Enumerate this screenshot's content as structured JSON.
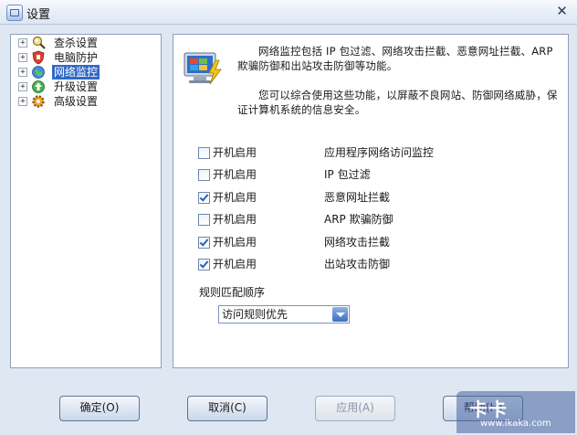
{
  "window": {
    "title": "设置",
    "close_symbol": "✕"
  },
  "tree": {
    "expander_symbol": "+",
    "items": [
      {
        "label": "查杀设置",
        "icon": "scan-icon"
      },
      {
        "label": "电脑防护",
        "icon": "shield-icon"
      },
      {
        "label": "网络监控",
        "icon": "network-icon",
        "selected": true
      },
      {
        "label": "升级设置",
        "icon": "update-icon"
      },
      {
        "label": "高级设置",
        "icon": "gear-icon"
      }
    ]
  },
  "content": {
    "desc_line1": "网络监控包括 IP 包过滤、网络攻击拦截、恶意网址拦截、ARP 欺骗防御和出站攻击防御等功能。",
    "desc_line2": "您可以综合使用这些功能，以屏蔽不良网站、防御网络威胁，保证计算机系统的信息安全。",
    "rows": [
      {
        "label": "开机启用",
        "feature": "应用程序网络访问监控",
        "checked": false
      },
      {
        "label": "开机启用",
        "feature": "IP 包过滤",
        "checked": false
      },
      {
        "label": "开机启用",
        "feature": "恶意网址拦截",
        "checked": true
      },
      {
        "label": "开机启用",
        "feature": "ARP 欺骗防御",
        "checked": false
      },
      {
        "label": "开机启用",
        "feature": "网络攻击拦截",
        "checked": true
      },
      {
        "label": "开机启用",
        "feature": "出站攻击防御",
        "checked": true
      }
    ],
    "rule_label": "规则匹配顺序",
    "rule_value": "访问规则优先"
  },
  "buttons": {
    "ok": "确定(O)",
    "cancel": "取消(C)",
    "apply": "应用(A)",
    "help": "帮助(H)"
  },
  "watermark": {
    "brand": "卡卡",
    "url": "www.ikaka.com"
  }
}
